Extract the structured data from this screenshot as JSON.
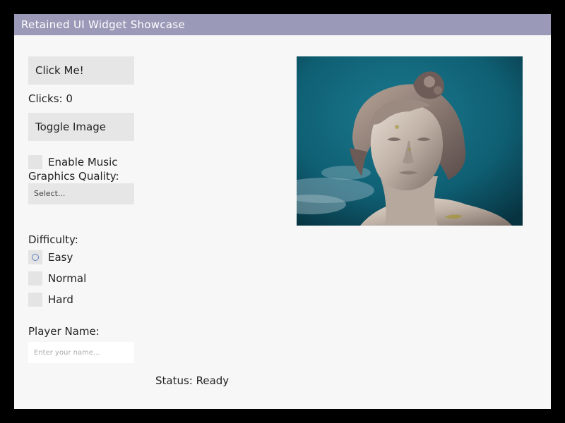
{
  "window": {
    "title": "Retained UI Widget Showcase"
  },
  "controls": {
    "click_button_label": "Click Me!",
    "clicks_text": "Clicks: 0",
    "toggle_button_label": "Toggle Image",
    "music_label": "Enable Music",
    "music_checked": false,
    "graphics_label": "Graphics Quality:",
    "graphics_select_value": "Select...",
    "difficulty_label": "Difficulty:",
    "difficulty_options": [
      "Easy",
      "Normal",
      "Hard"
    ],
    "difficulty_selected": "Easy",
    "player_name_label": "Player Name:",
    "player_name_value": "",
    "player_name_placeholder": "Enter your name..."
  },
  "status": {
    "text": "Status: Ready"
  },
  "image": {
    "subject": "statue-head-against-sky"
  },
  "colors": {
    "titlebar": "#9a99b8",
    "background": "#f7f7f8",
    "control": "#e6e6e6",
    "radio_accent": "#5b7fc0",
    "sky": "#0f5f73"
  }
}
